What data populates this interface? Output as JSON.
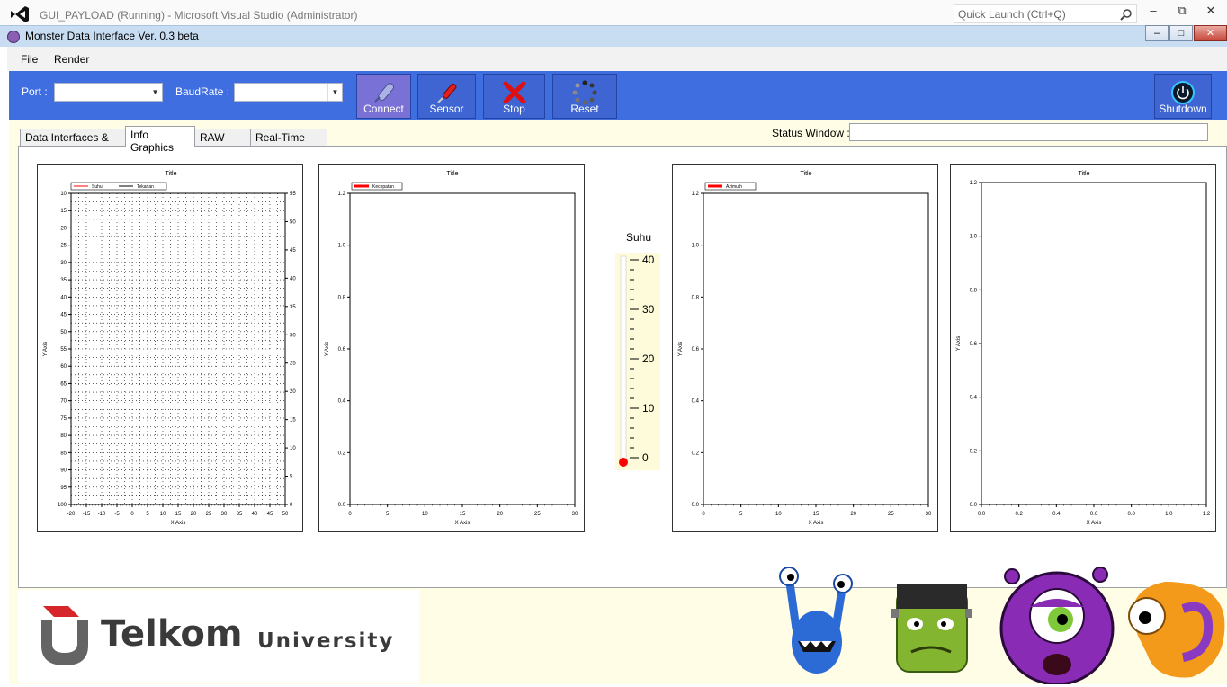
{
  "vs": {
    "title": "GUI_PAYLOAD (Running) - Microsoft Visual Studio (Administrator)",
    "quick_launch_placeholder": "Quick Launch (Ctrl+Q)"
  },
  "window": {
    "title": "Monster Data Interface Ver. 0.3 beta"
  },
  "menu": {
    "file": "File",
    "render": "Render"
  },
  "toolbar": {
    "port_label": "Port :",
    "port_value": "",
    "baud_label": "BaudRate :",
    "baud_value": "",
    "connect": "Connect",
    "sensor": "Sensor",
    "stop": "Stop",
    "reset": "Reset",
    "shutdown": "Shutdown"
  },
  "tabs": [
    {
      "label": "Data Interfaces & Map"
    },
    {
      "label": "Info Graphics"
    },
    {
      "label": "RAW Data"
    },
    {
      "label": "Real-Time Data"
    }
  ],
  "status": {
    "label": "Status Window :",
    "value": ""
  },
  "thermometer": {
    "title": "Suhu",
    "min": 0,
    "max": 40,
    "ticks": [
      0,
      10,
      20,
      30,
      40
    ],
    "value": 0
  },
  "logo": {
    "brand": "Telkom",
    "sub": "University"
  },
  "colors": {
    "toolbar": "#3f6ee1",
    "content": "#fffde6",
    "series_red": "#ff0000"
  },
  "chart_data": [
    {
      "type": "line",
      "title": "Title",
      "xlabel": "X Axis",
      "ylabel": "Y Axis",
      "xlim": [
        -20,
        50
      ],
      "x_ticks": [
        -20,
        -15,
        -10,
        -5,
        0,
        5,
        10,
        15,
        20,
        25,
        30,
        35,
        40,
        45,
        50
      ],
      "y_ticks": [
        10,
        15,
        20,
        25,
        30,
        35,
        40,
        45,
        50,
        55,
        60,
        65,
        70,
        75,
        80,
        85,
        90,
        95,
        100
      ],
      "y2_ticks": [
        55,
        50,
        45,
        40,
        35,
        30,
        25,
        20,
        15,
        10,
        5,
        0
      ],
      "grid": true,
      "legend": [
        "Suhu",
        "Tekanan"
      ],
      "series": [
        {
          "name": "Suhu",
          "values": []
        },
        {
          "name": "Tekanan",
          "values": []
        }
      ]
    },
    {
      "type": "line",
      "title": "Title",
      "xlabel": "X Axis",
      "ylabel": "Y Axis",
      "xlim": [
        0,
        30
      ],
      "ylim": [
        0,
        1.2
      ],
      "x_ticks": [
        0,
        5,
        10,
        15,
        20,
        25,
        30
      ],
      "y_ticks": [
        "0.0",
        "0.2",
        "0.4",
        "0.6",
        "0.8",
        "1.0",
        "1.2"
      ],
      "grid": false,
      "legend": [
        "Kecepatan"
      ],
      "series": [
        {
          "name": "Kecepatan",
          "values": []
        }
      ]
    },
    {
      "type": "line",
      "title": "Title",
      "xlabel": "X Axis",
      "ylabel": "Y Axis",
      "xlim": [
        0,
        30
      ],
      "ylim": [
        0,
        1.2
      ],
      "x_ticks": [
        0,
        5,
        10,
        15,
        20,
        25,
        30
      ],
      "y_ticks": [
        "0.0",
        "0.2",
        "0.4",
        "0.6",
        "0.8",
        "1.0",
        "1.2"
      ],
      "grid": false,
      "legend": [
        "Azimuth"
      ],
      "series": [
        {
          "name": "Azimuth",
          "values": []
        }
      ]
    },
    {
      "type": "line",
      "title": "Title",
      "xlabel": "X Axis",
      "ylabel": "Y Axis",
      "xlim": [
        0,
        1.2
      ],
      "ylim": [
        0,
        1.2
      ],
      "x_ticks": [
        "0.0",
        "0.2",
        "0.4",
        "0.6",
        "0.8",
        "1.0",
        "1.2"
      ],
      "y_ticks": [
        "0.0",
        "0.2",
        "0.4",
        "0.6",
        "0.8",
        "1.0",
        "1.2"
      ],
      "grid": false,
      "legend": [],
      "series": []
    }
  ]
}
